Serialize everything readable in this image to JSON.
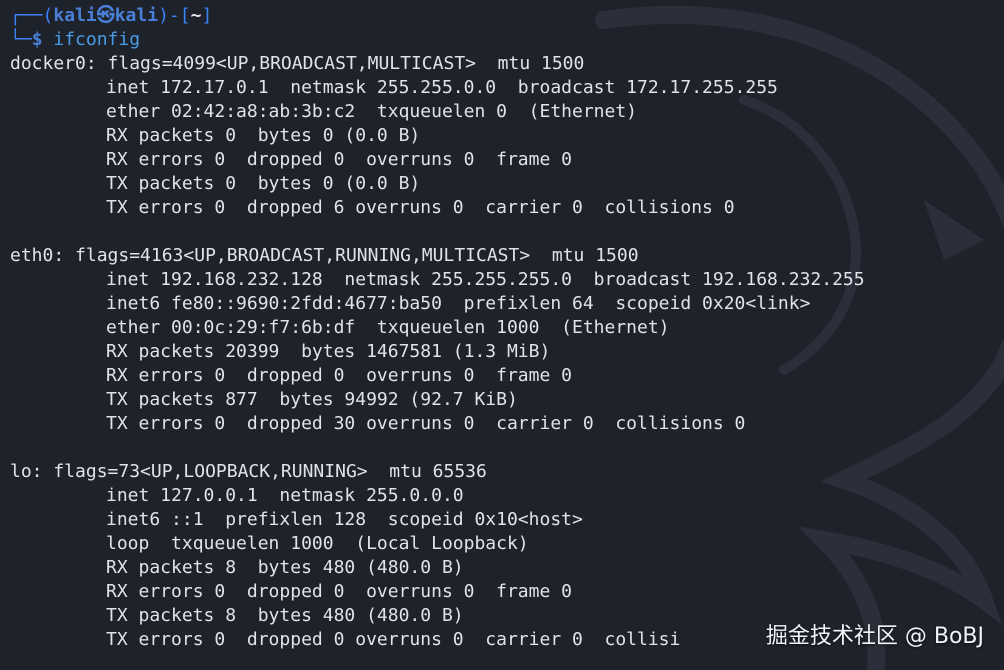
{
  "prompt": {
    "corner_top": "┌──(",
    "user": "kali",
    "separator": "㉿",
    "host": "kali",
    "close_paren": ")-[",
    "path": "~",
    "close_bracket": "]",
    "corner_bottom": "└─",
    "dollar": "$",
    "command": "ifconfig"
  },
  "interfaces": [
    {
      "header": "docker0: flags=4099<UP,BROADCAST,MULTICAST>  mtu 1500",
      "lines": [
        "inet 172.17.0.1  netmask 255.255.0.0  broadcast 172.17.255.255",
        "ether 02:42:a8:ab:3b:c2  txqueuelen 0  (Ethernet)",
        "RX packets 0  bytes 0 (0.0 B)",
        "RX errors 0  dropped 0  overruns 0  frame 0",
        "TX packets 0  bytes 0 (0.0 B)",
        "TX errors 0  dropped 6 overruns 0  carrier 0  collisions 0"
      ]
    },
    {
      "header": "eth0: flags=4163<UP,BROADCAST,RUNNING,MULTICAST>  mtu 1500",
      "lines": [
        "inet 192.168.232.128  netmask 255.255.255.0  broadcast 192.168.232.255",
        "inet6 fe80::9690:2fdd:4677:ba50  prefixlen 64  scopeid 0x20<link>",
        "ether 00:0c:29:f7:6b:df  txqueuelen 1000  (Ethernet)",
        "RX packets 20399  bytes 1467581 (1.3 MiB)",
        "RX errors 0  dropped 0  overruns 0  frame 0",
        "TX packets 877  bytes 94992 (92.7 KiB)",
        "TX errors 0  dropped 30 overruns 0  carrier 0  collisions 0"
      ]
    },
    {
      "header": "lo: flags=73<UP,LOOPBACK,RUNNING>  mtu 65536",
      "lines": [
        "inet 127.0.0.1  netmask 255.0.0.0",
        "inet6 ::1  prefixlen 128  scopeid 0x10<host>",
        "loop  txqueuelen 1000  (Local Loopback)",
        "RX packets 8  bytes 480 (480.0 B)",
        "RX errors 0  dropped 0  overruns 0  frame 0",
        "TX packets 8  bytes 480 (480.0 B)",
        "TX errors 0  dropped 0 overruns 0  carrier 0  collisi"
      ]
    }
  ],
  "watermark": "掘金技术社区 @ BoBJ",
  "colors": {
    "background": "#1e222b",
    "prompt_accent": "#3b82f6",
    "text": "#dfe3ea"
  }
}
